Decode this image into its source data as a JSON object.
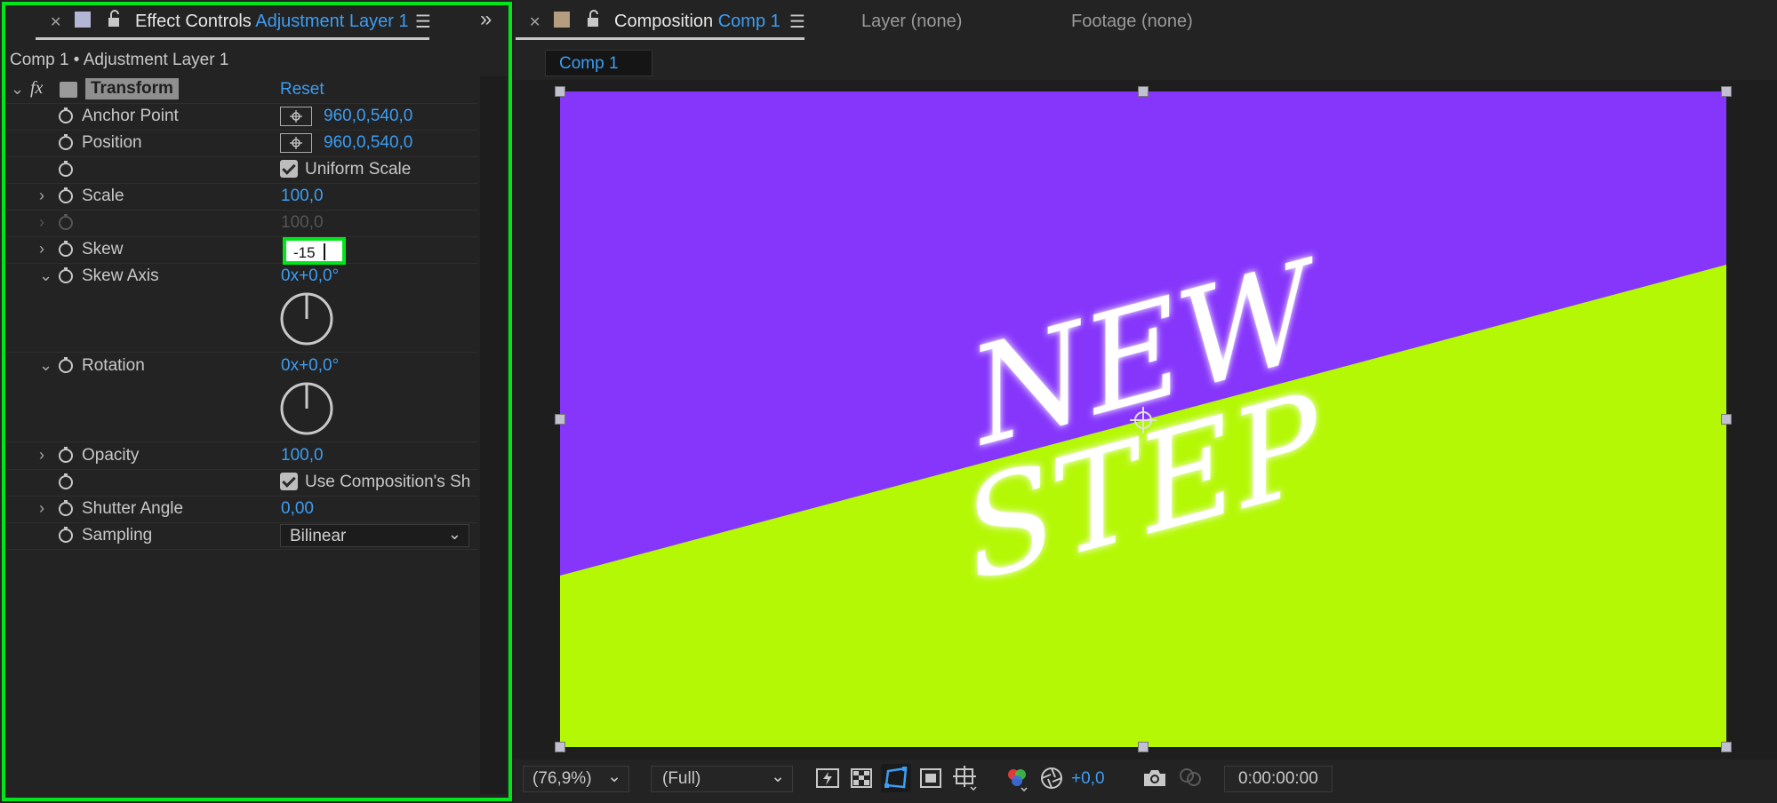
{
  "left_tab": {
    "title": "Effect Controls",
    "layer": "Adjustment Layer 1"
  },
  "breadcrumb": "Comp 1 • Adjustment Layer 1",
  "effect": {
    "fx_label": "fx",
    "name": "Transform",
    "reset_label": "Reset"
  },
  "properties": {
    "anchor_point": {
      "label": "Anchor Point",
      "value": "960,0,540,0"
    },
    "position": {
      "label": "Position",
      "value": "960,0,540,0"
    },
    "uniform_scale": {
      "label": "Uniform Scale"
    },
    "scale": {
      "label": "Scale",
      "value": "100,0"
    },
    "scale_height": {
      "value": "100,0"
    },
    "skew": {
      "label": "Skew",
      "input_value": "-15"
    },
    "skew_axis": {
      "label": "Skew Axis",
      "turns": "0x",
      "degrees": "+0,0°"
    },
    "rotation": {
      "label": "Rotation",
      "turns": "0x",
      "degrees": "+0,0°"
    },
    "opacity": {
      "label": "Opacity",
      "value": "100,0"
    },
    "use_comp_shutter": {
      "label": "Use Composition's Sh"
    },
    "shutter_angle": {
      "label": "Shutter Angle",
      "value": "0,00"
    },
    "sampling": {
      "label": "Sampling",
      "value": "Bilinear"
    }
  },
  "comp_tabs": {
    "composition_title": "Composition",
    "composition_name": "Comp 1",
    "layer_tab": "Layer (none)",
    "footage_tab": "Footage (none)",
    "subtab": "Comp 1"
  },
  "canvas_text": {
    "line1": "NEW",
    "line2": "STEP"
  },
  "canvas_colors": {
    "top": "#8636fb",
    "bottom": "#b5f806",
    "text": "#ffffff"
  },
  "viewer_bar": {
    "zoom": "(76,9%)",
    "resolution": "(Full)",
    "exposure": "+0,0",
    "timecode": "0:00:00:00"
  },
  "icons": [
    "close-icon",
    "lock-icon",
    "panel-menu-icon",
    "expand-panels-icon",
    "stopwatch-icon",
    "chevron-icon",
    "fast-preview-icon",
    "transparency-grid-icon",
    "mask-visibility-icon",
    "region-of-interest-icon",
    "guides-icon",
    "color-channels-icon",
    "exposure-icon",
    "snapshot-icon",
    "show-snapshot-icon"
  ]
}
